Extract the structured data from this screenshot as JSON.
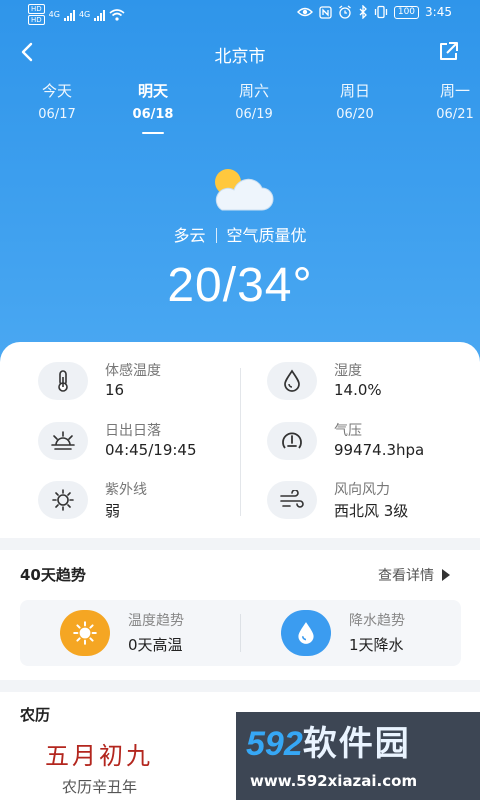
{
  "status_bar": {
    "hd_badges": [
      "HD",
      "HD"
    ],
    "signal_labels": [
      "4G",
      "4G"
    ],
    "icons": [
      "wifi-icon",
      "eye-icon",
      "nfc-icon",
      "alarm-icon",
      "bluetooth-icon",
      "vibrate-icon"
    ],
    "battery": "100",
    "time": "3:45"
  },
  "header": {
    "city": "北京市",
    "back_icon": "chevron-left-icon",
    "share_icon": "share-icon"
  },
  "days": [
    {
      "name": "今天",
      "date": "06/17",
      "active": false
    },
    {
      "name": "明天",
      "date": "06/18",
      "active": true
    },
    {
      "name": "周六",
      "date": "06/19",
      "active": false
    },
    {
      "name": "周日",
      "date": "06/20",
      "active": false
    },
    {
      "name": "周一",
      "date": "06/21",
      "active": false
    }
  ],
  "current": {
    "icon": "partly-cloudy-icon",
    "condition": "多云",
    "air_quality": "空气质量优",
    "temperature": "20/34°"
  },
  "details": {
    "feels_like": {
      "label": "体感温度",
      "value": "16",
      "icon": "thermometer-icon"
    },
    "humidity": {
      "label": "湿度",
      "value": "14.0%",
      "icon": "drop-icon"
    },
    "sunrise_sunset": {
      "label": "日出日落",
      "value": "04:45/19:45",
      "icon": "sunrise-icon"
    },
    "pressure": {
      "label": "气压",
      "value": "99474.3hpa",
      "icon": "gauge-icon"
    },
    "uv": {
      "label": "紫外线",
      "value": "弱",
      "icon": "sun-icon"
    },
    "wind": {
      "label": "风向风力",
      "value": "西北风 3级",
      "icon": "wind-icon"
    }
  },
  "trend": {
    "title": "40天趋势",
    "more_label": "查看详情",
    "temp": {
      "label": "温度趋势",
      "value": "0天高温",
      "icon": "sun-icon",
      "color": "#f5a623"
    },
    "rain": {
      "label": "降水趋势",
      "value": "1天降水",
      "icon": "drop-icon",
      "color": "#3b9cf0"
    }
  },
  "lunar": {
    "title": "农历",
    "date": "五月初九",
    "year": "农历辛丑年"
  },
  "watermark": {
    "brand": "592",
    "brand_cn": "软件园",
    "url": "www.592xiazai.com"
  },
  "colors": {
    "hero_top": "#2f95ea",
    "hero_bottom": "#4aa8f2",
    "lunar_red": "#b3261e"
  }
}
